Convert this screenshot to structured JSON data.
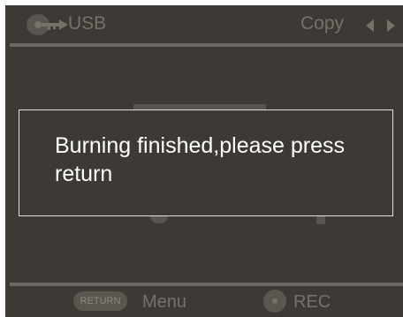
{
  "header": {
    "source_label": "USB",
    "source_icon": "usb-key-icon",
    "mode_label": "Copy",
    "prev_icon": "triangle-left-icon",
    "next_icon": "triangle-right-icon"
  },
  "dialog": {
    "message": "Burning finished,please press return"
  },
  "footer": {
    "return_button_label": "RETURN",
    "menu_label": "Menu",
    "rec_icon": "record-dot-icon",
    "rec_label": "REC"
  },
  "colors": {
    "background": "#3d3935",
    "dim_text": "#77716a",
    "dialog_border": "#e6e3df",
    "dialog_text": "#ffffff"
  }
}
